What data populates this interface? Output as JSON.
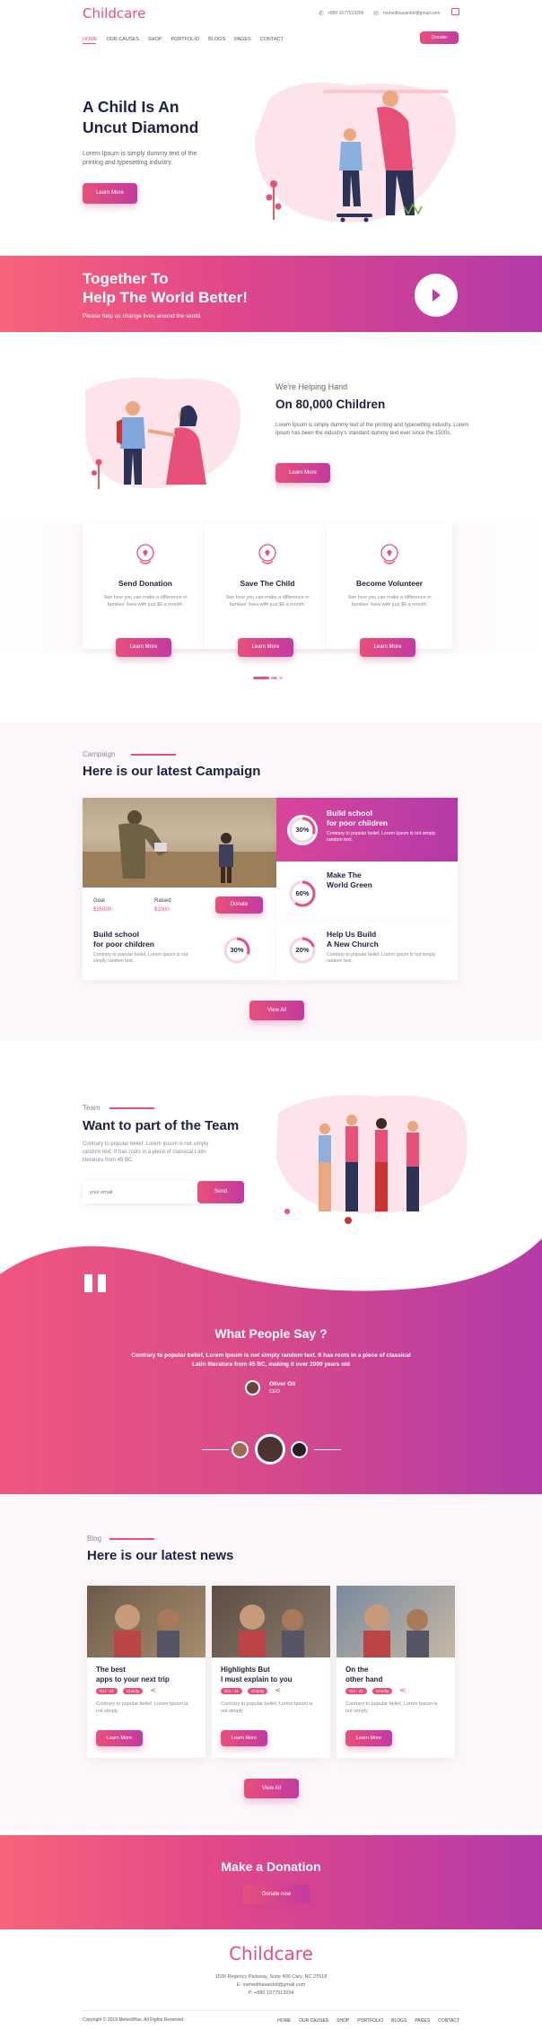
{
  "brand": "Childcare",
  "header": {
    "phone": "+880 1677513266",
    "email": "mehedihasanbd@gmail.com",
    "donate_label": "Donate"
  },
  "nav": [
    "HOME",
    "OUR CAUSES",
    "SHOP",
    "PORTFOLIO",
    "BLOGS",
    "PAGES",
    "CONTACT"
  ],
  "hero": {
    "title_line1": "A Child Is An",
    "title_line2": "Uncut Diamond",
    "text": "Lorem Ipsum is simply dummy text of the printing and typesetting industry.",
    "button": "Learn More"
  },
  "banner": {
    "title_line1": "Together To",
    "title_line2": "Help The World Better!",
    "subtitle": "Please help us change lives around the world."
  },
  "helping": {
    "eyebrow": "We're Helping Hand",
    "title": "On 80,000 Children",
    "text": "Lorem Ipsum is simply dummy text of the printing and typesetting industry. Lorem Ipsum has been the industry's standard dummy text ever since the 1500s.",
    "button": "Learn More"
  },
  "features": [
    {
      "icon": "heart-hand-icon",
      "title": "Send Donation",
      "text": "See how you can make a difference in families' lives with just $6 a month.",
      "button": "Learn More"
    },
    {
      "icon": "child-icon",
      "title": "Save The Child",
      "text": "See how you can make a difference in families' lives with just $6 a month.",
      "button": "Learn More"
    },
    {
      "icon": "volunteers-icon",
      "title": "Become Volunteer",
      "text": "See how you can make a difference in families' lives with just $6 a month.",
      "button": "Learn More"
    }
  ],
  "campaign": {
    "label": "Campaign",
    "title": "Here is our latest Campaign",
    "goal_label": "Goal",
    "goal_value": "$35000",
    "raised_label": "Raised",
    "raised_value": "$1000",
    "donate_label": "Donate",
    "items": [
      {
        "title_line1": "Build school",
        "title_line2": "for poor children",
        "text": "Contrary to popular belief, Lorem Ipsum is not simply random text.",
        "percent": "30%",
        "progress": 0.3
      },
      {
        "title_line1": "Make The",
        "title_line2": "World Green",
        "text": "",
        "percent": "60%",
        "progress": 0.6
      },
      {
        "title_line1": "Build school",
        "title_line2": "for poor children",
        "text": "Contrary to popular belief, Lorem Ipsum is not simply random text.",
        "percent": "30%",
        "progress": 0.3
      },
      {
        "title_line1": "Help Us Build",
        "title_line2": "A New Church",
        "text": "Contrary to popular belief, Lorem Ipsum is not simply random text.",
        "percent": "20%",
        "progress": 0.2
      }
    ],
    "view_all": "View All"
  },
  "team": {
    "label": "Team",
    "title": "Want to part of the Team",
    "text": "Contrary to popular belief, Lorem Ipsum is not simply random text. It has roots in a piece of classical Latin literature from 45 BC.",
    "email_placeholder": "your email",
    "send_label": "Send"
  },
  "testimonial": {
    "title": "What People Say ?",
    "quote": "Contrary to popular belief, Lorem Ipsum is not simply random text. It has roots in a piece of classical Latin literature from 45 BC, making it over 2000 years old",
    "name": "Oliver Oil",
    "role": "CEO"
  },
  "blog": {
    "label": "Blog",
    "title": "Here is our latest news",
    "posts": [
      {
        "title_line1": "The best",
        "title_line2": "apps to your next trip",
        "date": "Oct - 21",
        "tag": "Charity",
        "text": "Contrary to popular belief, Lorem Ipsum is not simply",
        "button": "Learn More"
      },
      {
        "title_line1": "Highlights But",
        "title_line2": "I must explain to you",
        "date": "Oct - 21",
        "tag": "Charity",
        "text": "Contrary to popular belief, Lorem Ipsum is not simply",
        "button": "Learn More"
      },
      {
        "title_line1": "On the",
        "title_line2": "other hand",
        "date": "Oct - 21",
        "tag": "Charity",
        "text": "Contrary to popular belief, Lorem Ipsum is not simply",
        "button": "Learn More"
      }
    ],
    "view_all": "View All"
  },
  "donation_cta": {
    "title": "Make a Donation",
    "button": "Donate now"
  },
  "footer": {
    "brand": "Childcare",
    "address": "1500 Regency Parkway, Suite 400 Cary, NC 27518",
    "email": "E: mehedihasanbd@gmail.com",
    "phone": "P: +880 1677513264",
    "copyright": "Copyright © 2019 MehediHas. All Rights Reserved.",
    "nav": [
      "HOME",
      "OUR CAUSES",
      "SHOP",
      "PORTFOLIO",
      "BLOGS",
      "PAGES",
      "CONTACT"
    ]
  },
  "colors": {
    "accent": "#e8507a",
    "purple": "#b43aa8",
    "dark": "#1f2240"
  }
}
